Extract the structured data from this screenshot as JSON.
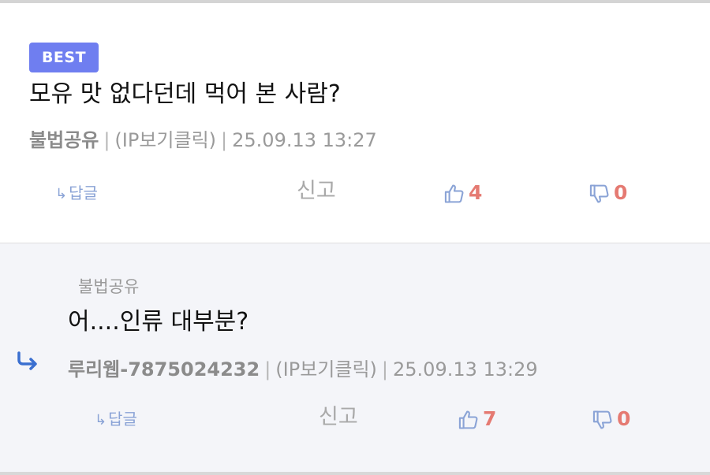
{
  "comments": [
    {
      "badge": "BEST",
      "text": "모유 맛 없다던데 먹어 본 사람?",
      "author": "불법공유",
      "ip": "(IP보기클릭)",
      "timestamp": "25.09.13 13:27",
      "actions": {
        "reply": "답글",
        "report": "신고",
        "likes": "4",
        "dislikes": "0"
      }
    },
    {
      "reply_to": "불법공유",
      "text": "어....인류 대부분?",
      "author": "루리웹-7875024232",
      "ip": "(IP보기클릭)",
      "timestamp": "25.09.13 13:29",
      "actions": {
        "reply": "답글",
        "report": "신고",
        "likes": "7",
        "dislikes": "0"
      }
    }
  ],
  "separator": "|",
  "colors": {
    "badge": "#6f7ef0",
    "reply_bg": "#f4f5f9",
    "vote_count": "#e57a72",
    "reply_link": "#8aa3d6",
    "thumb_icon": "#8aa3d6",
    "reply_arrow": "#3a6fd0"
  },
  "icons": {
    "reply_link": "return-arrow-icon",
    "like": "thumbs-up-icon",
    "dislike": "thumbs-down-icon",
    "reply_indicator": "reply-arrow-icon"
  }
}
